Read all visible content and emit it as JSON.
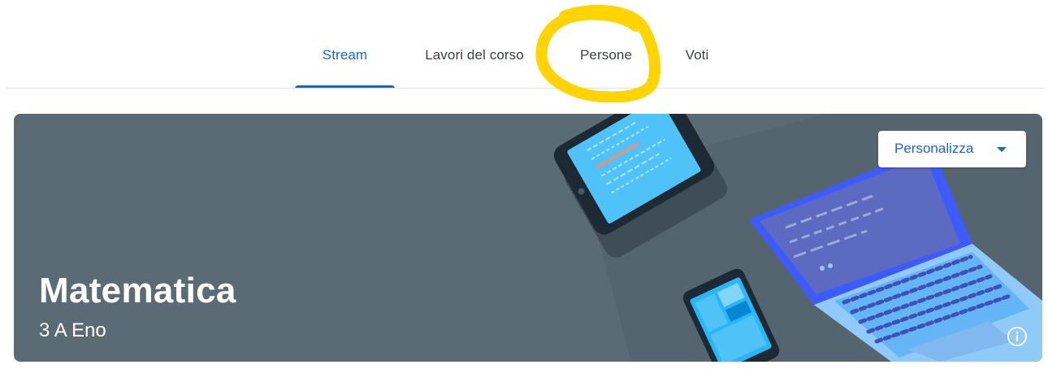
{
  "tabs": [
    {
      "label": "Stream",
      "active": true
    },
    {
      "label": "Lavori del corso",
      "active": false
    },
    {
      "label": "Persone",
      "active": false
    },
    {
      "label": "Voti",
      "active": false
    }
  ],
  "banner": {
    "title": "Matematica",
    "section": "3 A Eno",
    "customize_label": "Personalizza",
    "customize_icon": "arrow-drop-down-icon",
    "info_icon": "info-icon"
  },
  "colors": {
    "accent": "#1967d2",
    "banner_bg": "#5a6b76",
    "highlight": "#ffd400"
  }
}
